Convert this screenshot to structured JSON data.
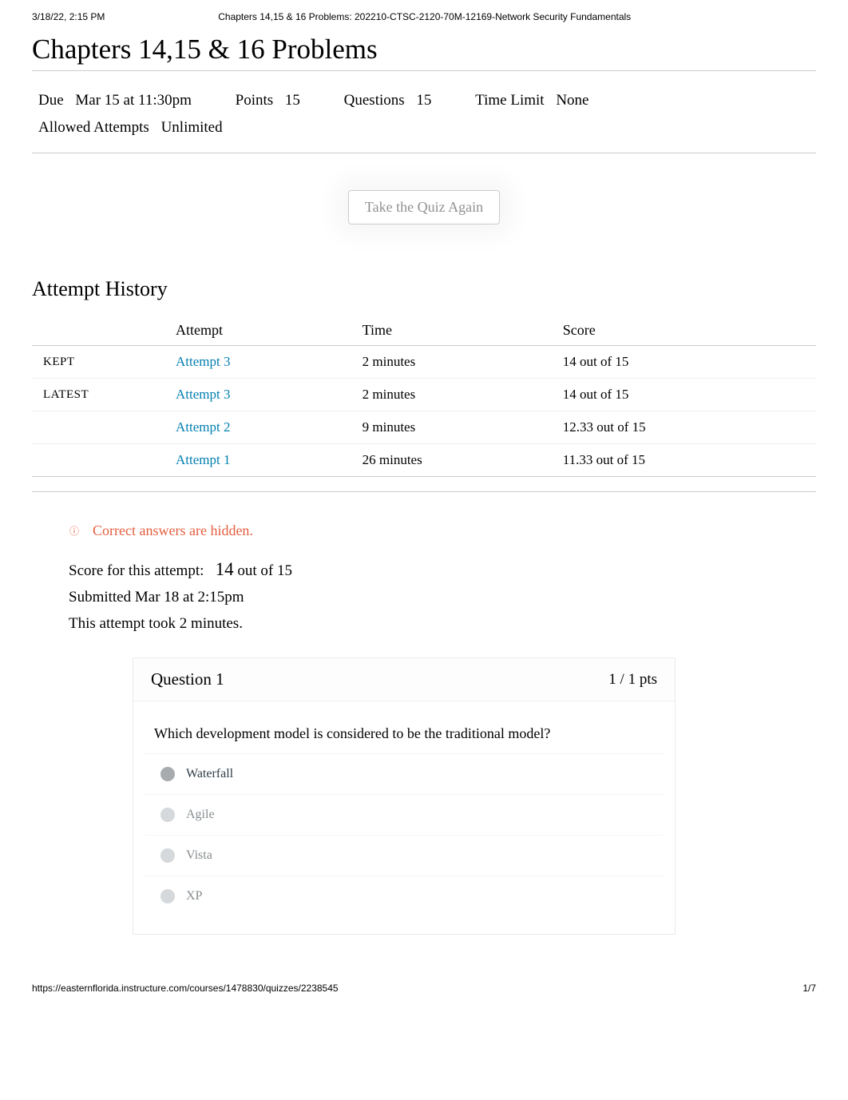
{
  "print_header": {
    "datetime": "3/18/22, 2:15 PM",
    "title": "Chapters 14,15 & 16 Problems: 202210-CTSC-2120-70M-12169-Network Security Fundamentals"
  },
  "page_title": "Chapters 14,15 & 16 Problems",
  "meta": {
    "due_label": "Due",
    "due_value": "Mar 15 at 11:30pm",
    "points_label": "Points",
    "points_value": "15",
    "questions_label": "Questions",
    "questions_value": "15",
    "timelimit_label": "Time Limit",
    "timelimit_value": "None",
    "allowed_label": "Allowed Attempts",
    "allowed_value": "Unlimited"
  },
  "take_again_label": "Take the Quiz Again",
  "attempt_history": {
    "title": "Attempt History",
    "columns": {
      "c0": "",
      "c1": "Attempt",
      "c2": "Time",
      "c3": "Score"
    },
    "rows": [
      {
        "tag": "KEPT",
        "attempt": "Attempt 3",
        "time": "2 minutes",
        "score": "14 out of 15"
      },
      {
        "tag": "LATEST",
        "attempt": "Attempt 3",
        "time": "2 minutes",
        "score": "14 out of 15"
      },
      {
        "tag": "",
        "attempt": "Attempt 2",
        "time": "9 minutes",
        "score": "12.33 out of 15"
      },
      {
        "tag": "",
        "attempt": "Attempt 1",
        "time": "26 minutes",
        "score": "11.33 out of 15"
      }
    ]
  },
  "hidden_note": {
    "icon": "ⓘ",
    "text": "Correct answers are hidden."
  },
  "score_block": {
    "line1_prefix": "Score for this attempt:",
    "line1_score": "14",
    "line1_suffix": "out of 15",
    "line2": "Submitted Mar 18 at 2:15pm",
    "line3": "This attempt took 2 minutes."
  },
  "question": {
    "title": "Question 1",
    "pts": "1 / 1 pts",
    "prompt": "Which development model is considered to be the traditional model?",
    "answers": [
      {
        "text": "Waterfall",
        "selected": true
      },
      {
        "text": "Agile",
        "selected": false
      },
      {
        "text": "Vista",
        "selected": false
      },
      {
        "text": "XP",
        "selected": false
      }
    ]
  },
  "print_footer": {
    "url": "https://easternflorida.instructure.com/courses/1478830/quizzes/2238545",
    "page": "1/7"
  }
}
